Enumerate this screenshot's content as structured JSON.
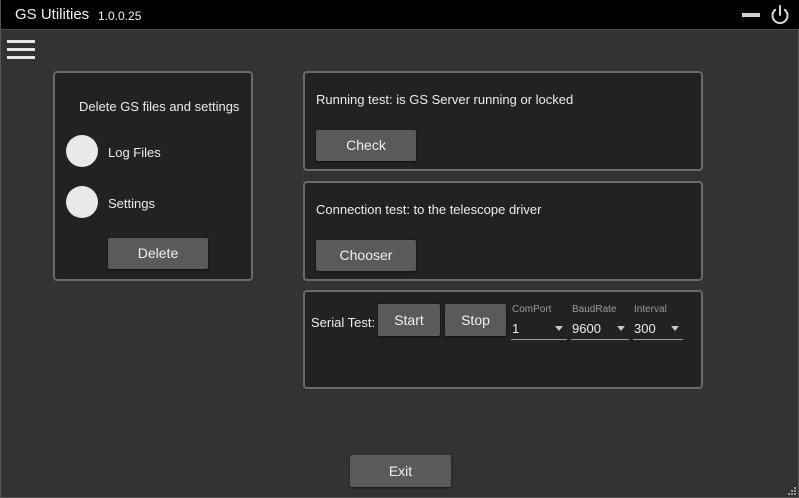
{
  "titlebar": {
    "title": "GS Utilities",
    "version": "1.0.0.25"
  },
  "delete_panel": {
    "heading": "Delete GS files and settings",
    "options": [
      {
        "label": "Log Files"
      },
      {
        "label": "Settings"
      }
    ],
    "delete_label": "Delete"
  },
  "running_panel": {
    "text": "Running test: is GS Server running or locked",
    "button_label": "Check"
  },
  "connection_panel": {
    "text": "Connection test: to the telescope driver",
    "button_label": "Chooser"
  },
  "serial_panel": {
    "label": "Serial Test:",
    "start_label": "Start",
    "stop_label": "Stop",
    "comport": {
      "caption": "ComPort",
      "value": "1"
    },
    "baudrate": {
      "caption": "BaudRate",
      "value": "9600"
    },
    "interval": {
      "caption": "Interval",
      "value": "300"
    }
  },
  "footer": {
    "exit_label": "Exit"
  },
  "icons": {
    "menu": "hamburger-menu-icon",
    "minimize": "minimize-icon",
    "power": "power-icon"
  },
  "colors": {
    "background": "#333333",
    "panel": "#222222",
    "panel_border": "#6a6a6a",
    "button": "#5a5a5a",
    "titlebar": "#000000"
  }
}
